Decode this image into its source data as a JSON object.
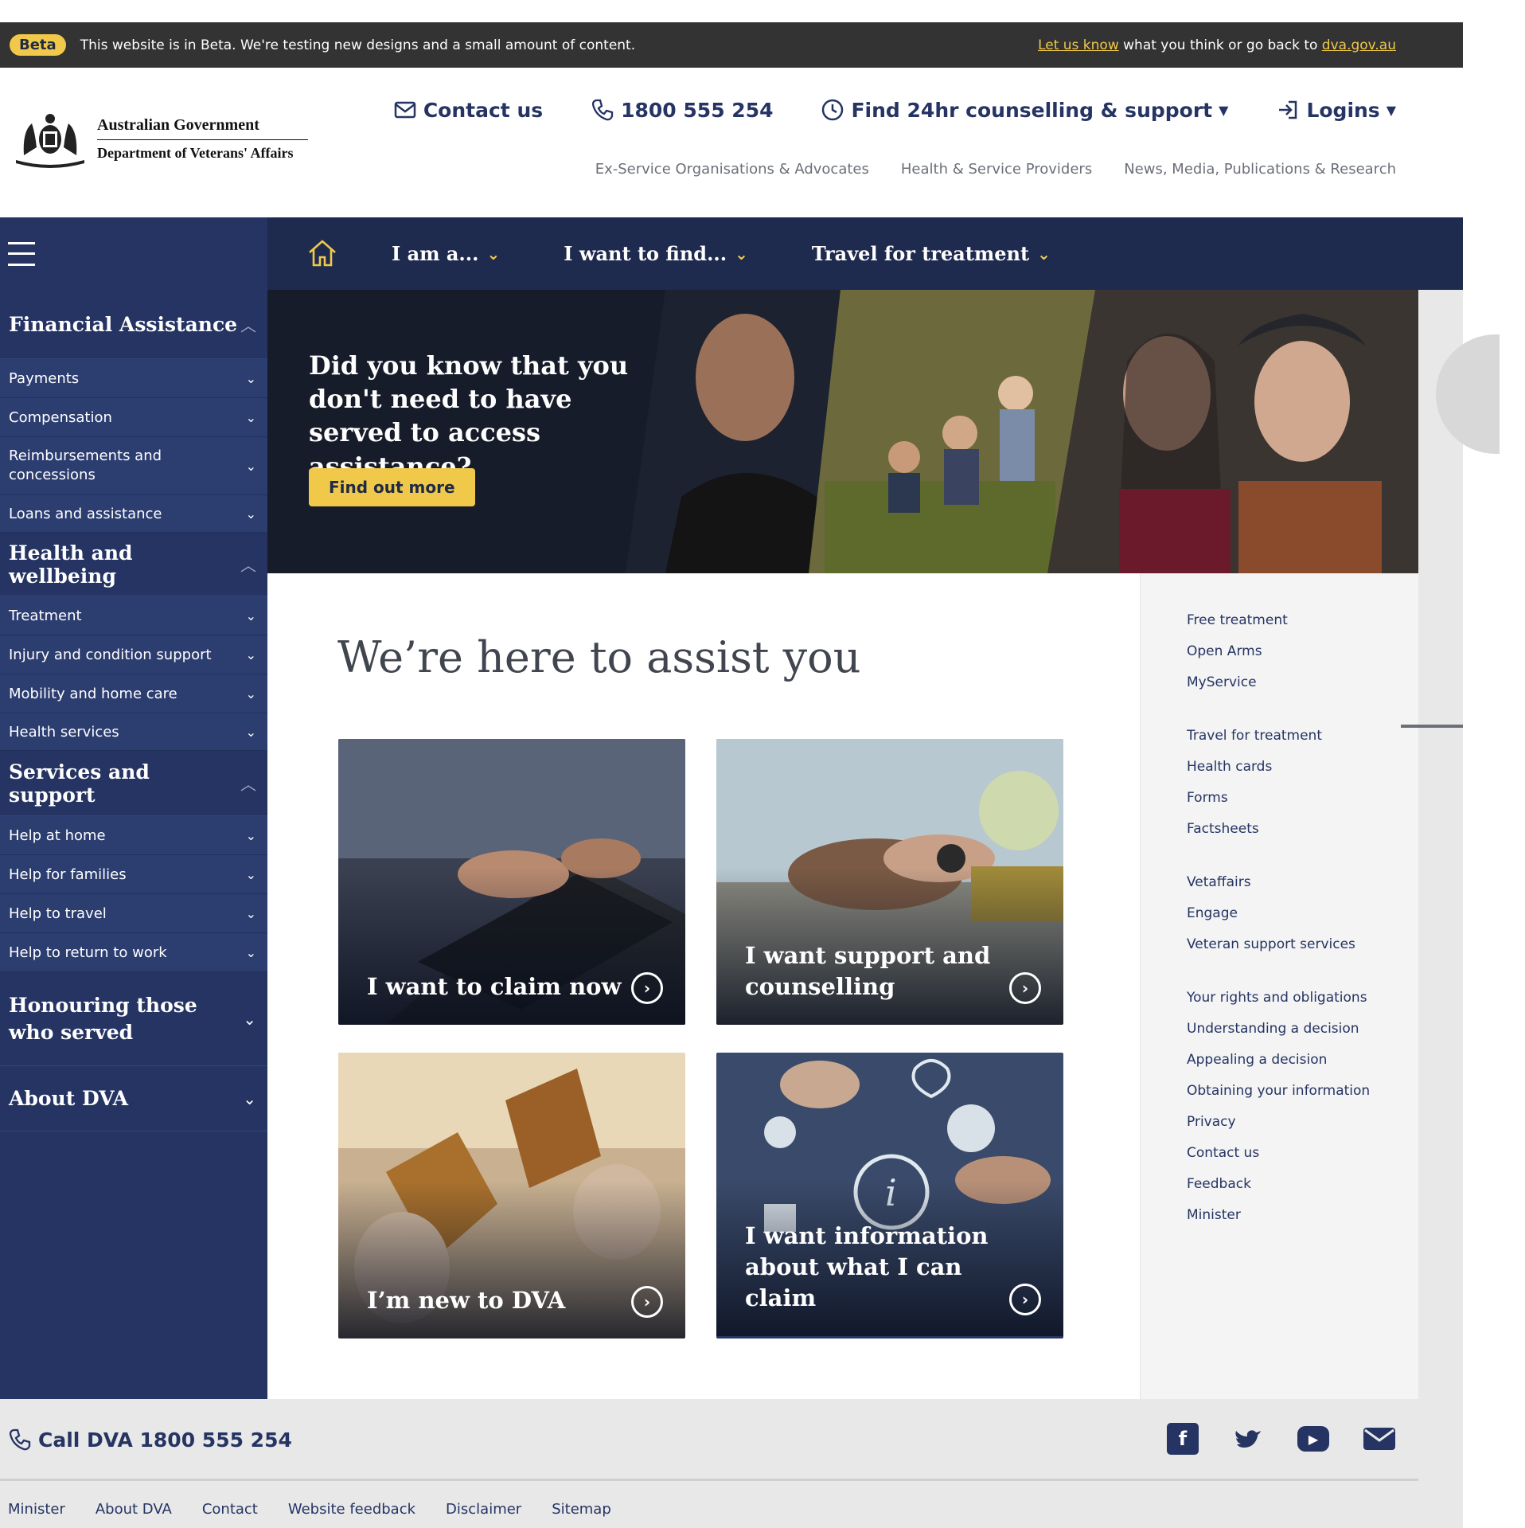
{
  "beta_bar": {
    "badge": "Beta",
    "message": "This website is in Beta. We're testing new designs and a small amount of content.",
    "feedback_link": "Let us know",
    "middle_text": " what you think or go back to ",
    "site_link": "dva.gov.au"
  },
  "header": {
    "logo_line1": "Australian Government",
    "logo_line2": "Department of Veterans' Affairs",
    "top_links": {
      "contact": "Contact us",
      "phone": "1800 555 254",
      "counselling": "Find 24hr counselling & support",
      "logins": "Logins"
    },
    "sub_links": [
      "Ex-Service Organisations & Advocates",
      "Health & Service Providers",
      "News, Media, Publications & Research"
    ]
  },
  "nav": {
    "items": [
      "I am a...",
      "I want to find...",
      "Travel for treatment"
    ]
  },
  "sidebar": {
    "sections": [
      {
        "title": "Financial Assistance",
        "expanded": true,
        "items": [
          "Payments",
          "Compensation",
          "Reimbursements and concessions",
          "Loans and assistance"
        ]
      },
      {
        "title": "Health and wellbeing",
        "expanded": true,
        "items": [
          "Treatment",
          "Injury and condition support",
          "Mobility and home care",
          "Health services"
        ]
      },
      {
        "title": "Services and support",
        "expanded": true,
        "items": [
          "Help at home",
          "Help for families",
          "Help to travel",
          "Help to return to work"
        ]
      },
      {
        "title": "Honouring those who served",
        "expanded": false,
        "items": []
      },
      {
        "title": "About DVA",
        "expanded": false,
        "items": []
      }
    ]
  },
  "hero": {
    "heading": "Did you know that you don't need to have served to access assistance?",
    "button": "Find out more"
  },
  "main": {
    "title": "We’re here to assist you",
    "cards": [
      "I want to claim now",
      "I want support and counselling",
      "I’m new to DVA",
      "I want information about what I can claim"
    ]
  },
  "right_links": {
    "group1": [
      "Free treatment",
      "Open Arms",
      "MyService"
    ],
    "group2": [
      "Travel for treatment",
      "Health cards",
      "Forms",
      "Factsheets"
    ],
    "group3": [
      "Vetaffairs",
      "Engage",
      "Veteran support services"
    ],
    "group4": [
      "Your rights and obligations",
      "Understanding a decision",
      "Appealing a decision",
      "Obtaining your information",
      "Privacy",
      "Contact us",
      "Feedback",
      "Minister"
    ]
  },
  "footer": {
    "call": "Call DVA 1800 555 254",
    "social": [
      "facebook-icon",
      "twitter-icon",
      "youtube-icon",
      "email-icon"
    ],
    "links": [
      "Minister",
      "About DVA",
      "Contact",
      "Website feedback",
      "Disclaimer",
      "Sitemap"
    ]
  },
  "colors": {
    "navy": "#253463",
    "nav_dark": "#1f2a4f",
    "accent_yellow": "#f0c94a",
    "beta_bar": "#333333"
  }
}
